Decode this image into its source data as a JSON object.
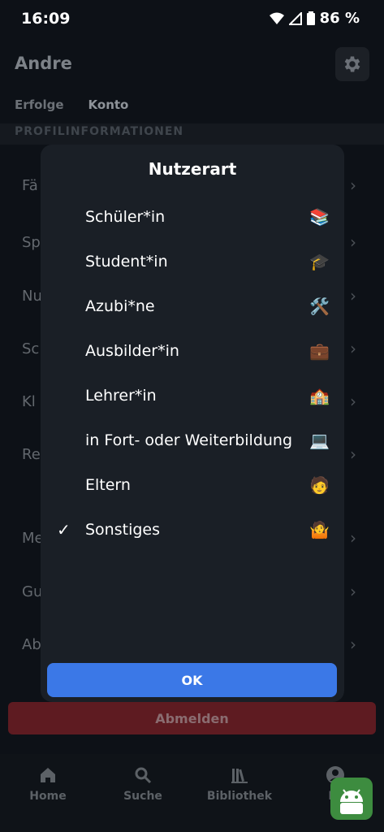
{
  "status_bar": {
    "time": "16:09",
    "battery": "86 %"
  },
  "header": {
    "title": "Andre",
    "settings_icon": "gear-icon"
  },
  "tabs": [
    {
      "label": "Erfolge"
    },
    {
      "label": "Konto"
    }
  ],
  "section_header": "PROFILINFORMATIONEN",
  "background_rows": [
    {
      "label": "Fä"
    },
    {
      "label": "Sp"
    },
    {
      "label": "Nu"
    },
    {
      "label": "Sc"
    },
    {
      "label": "Kl"
    },
    {
      "label": "Re"
    },
    {
      "label": "Me"
    },
    {
      "label": "Gu"
    },
    {
      "label": "Ab"
    }
  ],
  "logout_label": "Abmelden",
  "bottom_nav": [
    {
      "label": "Home",
      "icon": "home-icon"
    },
    {
      "label": "Suche",
      "icon": "search-icon"
    },
    {
      "label": "Bibliothek",
      "icon": "library-icon"
    },
    {
      "label": "Pr",
      "icon": "profile-icon"
    }
  ],
  "dialog": {
    "title": "Nutzerart",
    "options": [
      {
        "label": "Schüler*in",
        "emoji": "📚",
        "selected": false
      },
      {
        "label": "Student*in",
        "emoji": "🎓",
        "selected": false
      },
      {
        "label": "Azubi*ne",
        "emoji": "🛠️",
        "selected": false
      },
      {
        "label": "Ausbilder*in",
        "emoji": "💼",
        "selected": false
      },
      {
        "label": "Lehrer*in",
        "emoji": "🏫",
        "selected": false
      },
      {
        "label": "in Fort- oder Weiterbildung",
        "emoji": "💻",
        "selected": false
      },
      {
        "label": "Eltern",
        "emoji": "🧑",
        "selected": false
      },
      {
        "label": "Sonstiges",
        "emoji": "🤷",
        "selected": true
      }
    ],
    "ok_label": "OK"
  },
  "colors": {
    "accent": "#3b78e7",
    "logout": "#5e1b21",
    "dialog_bg": "#1a1f26",
    "page_bg": "#0d1117"
  }
}
